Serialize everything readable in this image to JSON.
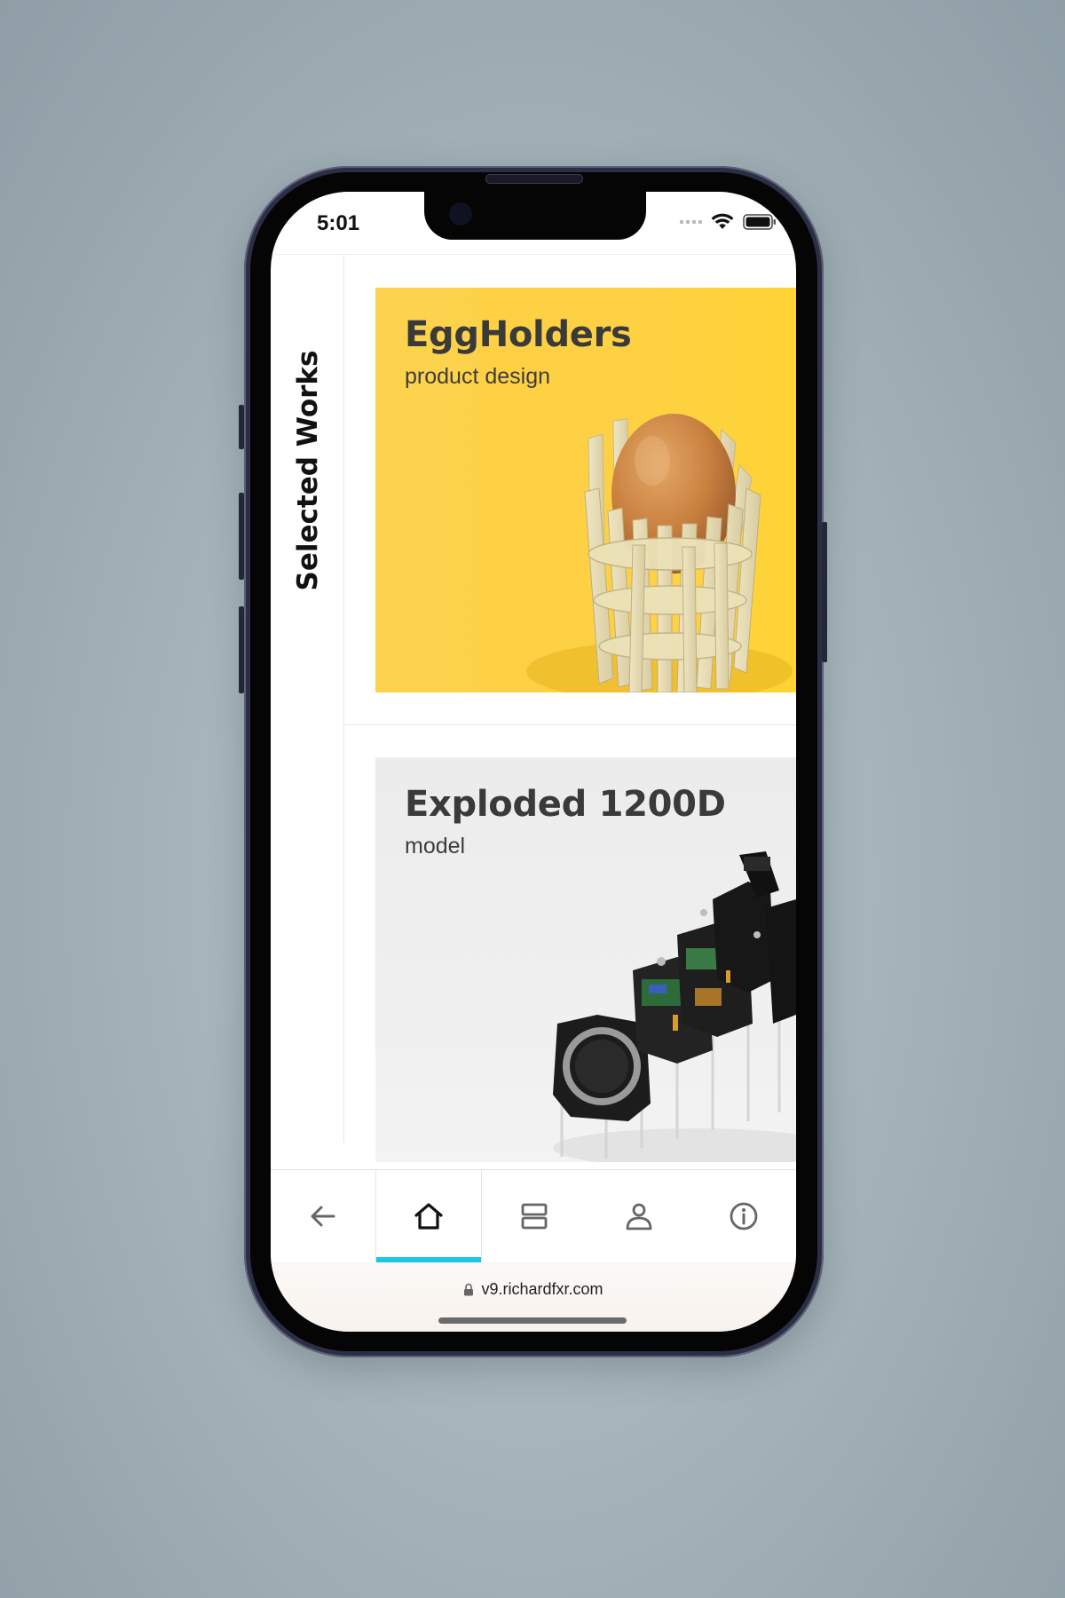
{
  "status_bar": {
    "time": "5:01",
    "icons": [
      "signal-dots-icon",
      "wifi-icon",
      "battery-icon"
    ]
  },
  "section": {
    "title": "Selected Works"
  },
  "works": [
    {
      "title": "EggHolders",
      "subtitle": "product design",
      "image": "egg-in-wooden-holder",
      "background": "#FDD24A"
    },
    {
      "title": "Exploded 1200D",
      "subtitle": "model",
      "image": "exploded-camera-model",
      "background": "#EFEFEF"
    }
  ],
  "tab_bar": {
    "tabs": [
      {
        "icon": "arrow-left-icon",
        "active": false
      },
      {
        "icon": "home-icon",
        "active": true
      },
      {
        "icon": "layout-rows-icon",
        "active": false
      },
      {
        "icon": "user-icon",
        "active": false
      },
      {
        "icon": "info-icon",
        "active": false
      }
    ],
    "active_color": "#1EC8E3"
  },
  "address_bar": {
    "url": "v9.richardfxr.com",
    "icon": "lock-icon"
  }
}
